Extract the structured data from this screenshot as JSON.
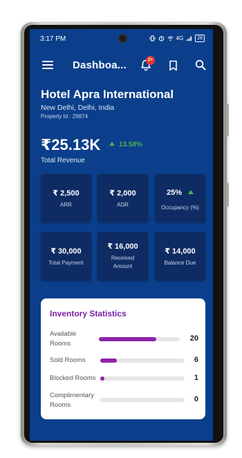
{
  "status_bar": {
    "time": "3:17 PM",
    "network": "4G",
    "battery": "28"
  },
  "app_bar": {
    "title": "Dashboa...",
    "notification_badge": "2+"
  },
  "hotel": {
    "name": "Hotel Apra International",
    "location": "New Delhi, Delhi, India",
    "property_id": "Property Id : 29874"
  },
  "revenue": {
    "value": "₹25.13K",
    "change": "13.58%",
    "label": "Total Revenue",
    "change_color": "#4caf50"
  },
  "metrics": [
    {
      "value": "₹ 2,500",
      "label": "ARR"
    },
    {
      "value": "₹ 2,000",
      "label": "ADR"
    },
    {
      "value": "25%",
      "label": "Occupancy (%)"
    },
    {
      "value": "₹ 30,000",
      "label": "Total Payment"
    },
    {
      "value": "₹ 16,000",
      "label": "Received Amount"
    },
    {
      "value": "₹ 14,000",
      "label": "Balance Due"
    }
  ],
  "inventory": {
    "title": "Inventory Statistics",
    "rows": [
      {
        "label": "Available Rooms",
        "value": "20",
        "fill_fraction": 0.71
      },
      {
        "label": "Sold Rooms",
        "value": "6",
        "fill_fraction": 0.2
      },
      {
        "label": "Blocked Rooms",
        "value": "1",
        "fill_fraction": 0.05
      },
      {
        "label": "Complimentary Rooms",
        "value": "0",
        "fill_fraction": 0
      }
    ]
  },
  "colors": {
    "primary": "#0b3f8b",
    "card": "#0e2c63",
    "accent_purple": "#8e24aa",
    "badge_red": "#e53935"
  }
}
